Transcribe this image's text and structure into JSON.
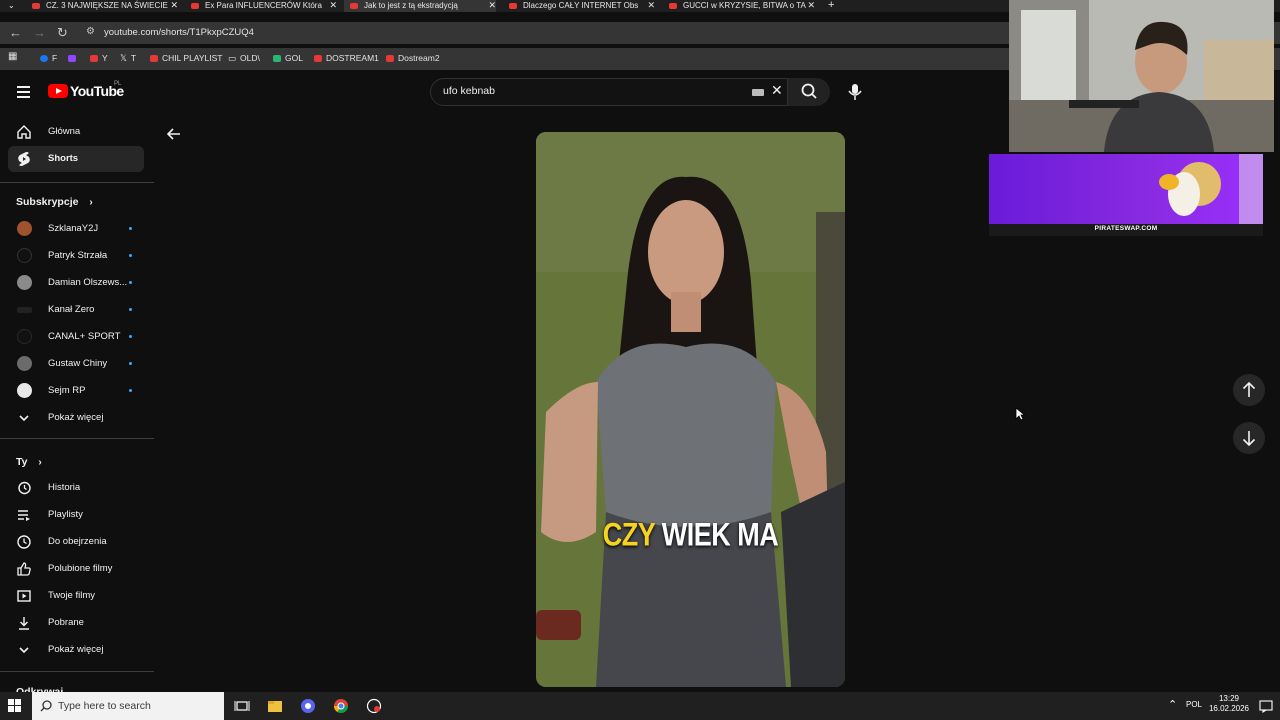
{
  "browser": {
    "tabs": [
      {
        "title": "CZ. 3 NAJWIĘKSZE NA ŚWIECIE"
      },
      {
        "title": "Ex Para INFLUENCERÓW Która"
      },
      {
        "title": "Jak to jest z tą ekstradycją"
      },
      {
        "title": "Dlaczego CAŁY INTERNET Obs"
      },
      {
        "title": "GUCCI w KRYZYSIE, BITWA o TA"
      }
    ],
    "url": "youtube.com/shorts/T1PkxpCZUQ4",
    "bookmarks": [
      "F",
      "Y",
      "T",
      "CHIL PLAYLIST",
      "OLD\\",
      "GOL",
      "DOSTREAM1",
      "Dostream2"
    ]
  },
  "youtube": {
    "logo_text": "YouTube",
    "region": "PL",
    "search_value": "ufo kebnab",
    "nav": [
      {
        "label": "Główna"
      },
      {
        "label": "Shorts"
      }
    ],
    "subscriptions_heading": "Subskrypcje",
    "subscriptions": [
      {
        "label": "SzklanaY2J"
      },
      {
        "label": "Patryk Strzała"
      },
      {
        "label": "Damian Olszews..."
      },
      {
        "label": "Kanał Zero"
      },
      {
        "label": "CANAL+ SPORT"
      },
      {
        "label": "Gustaw Chiny"
      },
      {
        "label": "Sejm RP"
      }
    ],
    "show_more": "Pokaż więcej",
    "you_heading": "Ty",
    "you_items": [
      {
        "label": "Historia"
      },
      {
        "label": "Playlisty"
      },
      {
        "label": "Do obejrzenia"
      },
      {
        "label": "Polubione filmy"
      },
      {
        "label": "Twoje filmy"
      },
      {
        "label": "Pobrane"
      }
    ],
    "explore_heading": "Odkrywaj",
    "caption_highlight": "CZY",
    "caption_rest": " WIEK MA"
  },
  "overlay": {
    "ad_text": "PIRATESWAP.COM"
  },
  "taskbar": {
    "search_placeholder": "Type here to search",
    "lang": "POL",
    "time": "13:29",
    "date": "16.02.2026"
  },
  "colors": {
    "accent_red": "#ff0000",
    "dot_blue": "#3ea6ff",
    "caption_yellow": "#f5d31f"
  }
}
